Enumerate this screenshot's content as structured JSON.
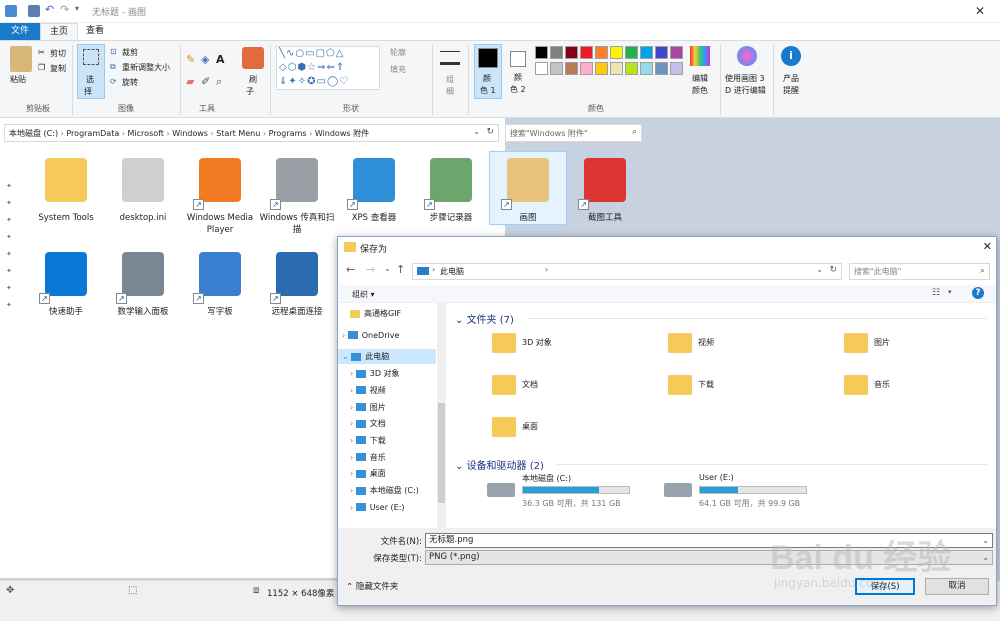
{
  "window": {
    "title": "无标题 - 画图",
    "close": "✕"
  },
  "tabs": {
    "file": "文件",
    "home": "主页",
    "view": "查看"
  },
  "ribbon": {
    "clipboard": {
      "paste": "粘贴",
      "cut": "剪切",
      "copy": "复制",
      "label": "剪贴板"
    },
    "image": {
      "select": "选",
      "select2": "择",
      "crop": "裁剪",
      "resize": "重新调整大小",
      "rotate": "旋转",
      "label": "图像"
    },
    "tools": {
      "label": "工具"
    },
    "brush": {
      "line1": "刷",
      "line2": "子"
    },
    "shapes": {
      "outline": "轮廓",
      "fill": "填充",
      "label": "形状"
    },
    "size": {
      "line1": "组",
      "line2": "细"
    },
    "colors": {
      "c1a": "颜",
      "c1b": "色 1",
      "c2a": "颜",
      "c2b": "色 2",
      "edit_a": "编辑",
      "edit_b": "颜色",
      "label": "颜色"
    },
    "paint3d": {
      "a": "使用画图 3",
      "b": "D 进行编辑"
    },
    "alert": {
      "a": "产品",
      "b": "提醒"
    },
    "palette_top": [
      "#000000",
      "#7f7f7f",
      "#880015",
      "#ed1c24",
      "#ff7f27",
      "#fff200",
      "#22b14c",
      "#00a2e8",
      "#3f48cc",
      "#a349a4"
    ],
    "palette_bottom": [
      "#ffffff",
      "#c3c3c3",
      "#b97a57",
      "#ffaec9",
      "#ffc90e",
      "#efe4b0",
      "#b5e61d",
      "#99d9ea",
      "#7092be",
      "#c8bfe7"
    ]
  },
  "address": {
    "crumbs": [
      "本地磁盘 (C:)",
      "ProgramData",
      "Microsoft",
      "Windows",
      "Start Menu",
      "Programs",
      "Windows 附件"
    ],
    "search_placeholder": "搜索\"Windows 附件\""
  },
  "explorer_items_row1": [
    {
      "label": "System Tools",
      "icon": "folder-icon"
    },
    {
      "label": "desktop.ini",
      "icon": "settings-file-icon"
    },
    {
      "label": "Windows Media Player",
      "icon": "media-player-icon"
    },
    {
      "label": "Windows 传真和扫描",
      "icon": "fax-icon"
    },
    {
      "label": "XPS 查看器",
      "icon": "xps-icon"
    },
    {
      "label": "步骤记录器",
      "icon": "steps-recorder-icon"
    },
    {
      "label": "画图",
      "icon": "paint-icon"
    },
    {
      "label": "截图工具",
      "icon": "snipping-tool-icon"
    }
  ],
  "explorer_items_row2": [
    {
      "label": "快速助手",
      "icon": "quick-assist-icon"
    },
    {
      "label": "数学输入面板",
      "icon": "math-input-icon"
    },
    {
      "label": "写字板",
      "icon": "wordpad-icon"
    },
    {
      "label": "远程桌面连接",
      "icon": "remote-desktop-icon"
    }
  ],
  "statusbar": {
    "size": "1152 × 648像素"
  },
  "dialog": {
    "title": "保存为",
    "close": "✕",
    "path": "此电脑",
    "search_placeholder": "搜索\"此电脑\"",
    "organize": "组织 ▾",
    "tree": [
      {
        "label": "高通格GIF",
        "indent": 1
      },
      {
        "label": "OneDrive",
        "indent": 0
      },
      {
        "label": "此电脑",
        "indent": 0,
        "selected": true
      },
      {
        "label": "3D 对象",
        "indent": 1
      },
      {
        "label": "视频",
        "indent": 1
      },
      {
        "label": "图片",
        "indent": 1
      },
      {
        "label": "文档",
        "indent": 1
      },
      {
        "label": "下载",
        "indent": 1
      },
      {
        "label": "音乐",
        "indent": 1
      },
      {
        "label": "桌面",
        "indent": 1
      },
      {
        "label": "本地磁盘 (C:)",
        "indent": 1
      },
      {
        "label": "User (E:)",
        "indent": 1
      }
    ],
    "folders_header": "文件夹 (7)",
    "folders": [
      "3D 对象",
      "视频",
      "图片",
      "文档",
      "下载",
      "音乐",
      "桌面"
    ],
    "devices_header": "设备和驱动器 (2)",
    "drives": [
      {
        "name": "本地磁盘 (C:)",
        "detail": "36.3 GB 可用，共 131 GB",
        "used_fraction": 0.72
      },
      {
        "name": "User (E:)",
        "detail": "64.1 GB 可用，共 99.9 GB",
        "used_fraction": 0.36
      }
    ],
    "filename_label": "文件名(N):",
    "filename": "无标题.png",
    "filetype_label": "保存类型(T):",
    "filetype": "PNG (*.png)",
    "hide_folders": "隐藏文件夹",
    "save": "保存(S)",
    "cancel": "取消"
  },
  "watermark": {
    "brand": "Bai du 经验",
    "url": "jingyan.baidu.com"
  }
}
